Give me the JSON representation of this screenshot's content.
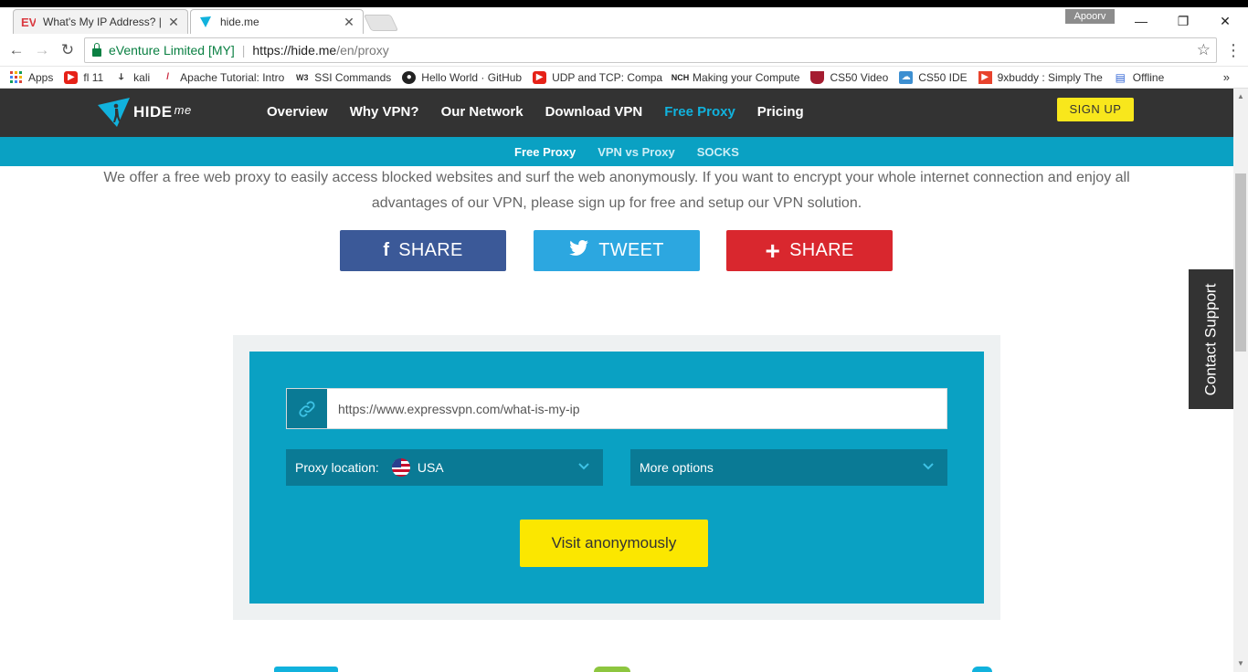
{
  "browser": {
    "tabs": [
      {
        "title": "What's My IP Address? |",
        "active": false
      },
      {
        "title": "hide.me",
        "active": true
      }
    ],
    "profile": "Apoorv",
    "site_identity": "eVenture Limited [MY]",
    "url_host": "https://hide.me",
    "url_path": "/en/proxy",
    "bookmarks": [
      {
        "label": "Apps",
        "icon": "apps-grid-icon"
      },
      {
        "label": "fl 11",
        "icon": "youtube-icon"
      },
      {
        "label": "kali",
        "icon": "kali-icon"
      },
      {
        "label": "Apache Tutorial: Intro",
        "icon": "apache-feather-icon"
      },
      {
        "label": "SSI Commands",
        "icon": "w3schools-icon"
      },
      {
        "label": "Hello World · GitHub",
        "icon": "github-icon"
      },
      {
        "label": "UDP and TCP: Compa",
        "icon": "youtube-icon"
      },
      {
        "label": "Making your Compute",
        "icon": "nch-icon"
      },
      {
        "label": "CS50 Video",
        "icon": "harvard-shield-icon"
      },
      {
        "label": "CS50 IDE",
        "icon": "cs50-ide-icon"
      },
      {
        "label": "9xbuddy : Simply The",
        "icon": "9xbuddy-icon"
      },
      {
        "label": "Offline",
        "icon": "reading-list-icon"
      }
    ]
  },
  "site": {
    "logo_text": "HIDE",
    "logo_suffix": "me",
    "nav": [
      "Overview",
      "Why VPN?",
      "Our Network",
      "Download VPN",
      "Free Proxy",
      "Pricing"
    ],
    "nav_active": "Free Proxy",
    "signup": "SIGN UP",
    "subnav": [
      "Free Proxy",
      "VPN vs Proxy",
      "SOCKS"
    ],
    "subnav_active": "Free Proxy"
  },
  "content": {
    "intro_line1": "We offer a free web proxy to easily access blocked websites and surf the web anonymously. If you want to encrypt your whole internet connection and enjoy all",
    "intro_line2": "advantages of our VPN, please sign up for free and setup our VPN solution.",
    "share_facebook": "SHARE",
    "share_twitter": "TWEET",
    "share_google": "SHARE",
    "url_value": "https://www.expressvpn.com/what-is-my-ip",
    "proxy_location_label": "Proxy location:",
    "proxy_location_value": "USA",
    "more_options": "More options",
    "visit_button": "Visit anonymously",
    "contact_support": "Contact Support"
  },
  "colors": {
    "header_bg": "#333333",
    "accent": "#0aa1c3",
    "accent_dark": "#0a7a95",
    "signup_yellow": "#f8e71c",
    "facebook": "#3b5998",
    "twitter": "#2ca7e0",
    "google": "#d9272e"
  }
}
